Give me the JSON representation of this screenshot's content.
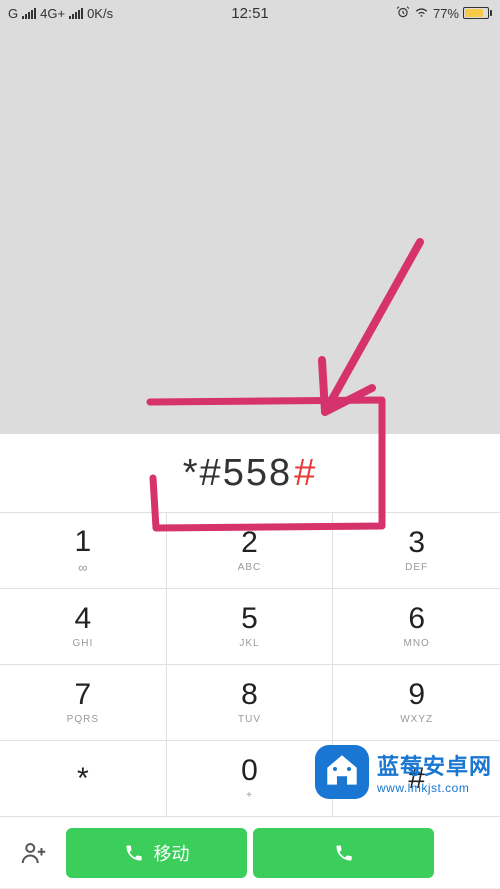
{
  "status": {
    "carrier": "G",
    "network": "4G+",
    "speed": "0K/s",
    "time": "12:51",
    "battery_pct": "77%"
  },
  "dial": {
    "entered": "*#558",
    "entered_last": "#"
  },
  "keys": [
    {
      "digit": "1",
      "sub": "∞"
    },
    {
      "digit": "2",
      "sub": "ABC"
    },
    {
      "digit": "3",
      "sub": "DEF"
    },
    {
      "digit": "4",
      "sub": "GHI"
    },
    {
      "digit": "5",
      "sub": "JKL"
    },
    {
      "digit": "6",
      "sub": "MNO"
    },
    {
      "digit": "7",
      "sub": "PQRS"
    },
    {
      "digit": "8",
      "sub": "TUV"
    },
    {
      "digit": "9",
      "sub": "WXYZ"
    },
    {
      "digit": "*",
      "sub": ""
    },
    {
      "digit": "0",
      "sub": "+"
    },
    {
      "digit": "#",
      "sub": ""
    }
  ],
  "actions": {
    "call1_label": "移动",
    "call2_label": ""
  },
  "watermark": {
    "title": "蓝莓安卓网",
    "url": "www.lmkjst.com"
  }
}
